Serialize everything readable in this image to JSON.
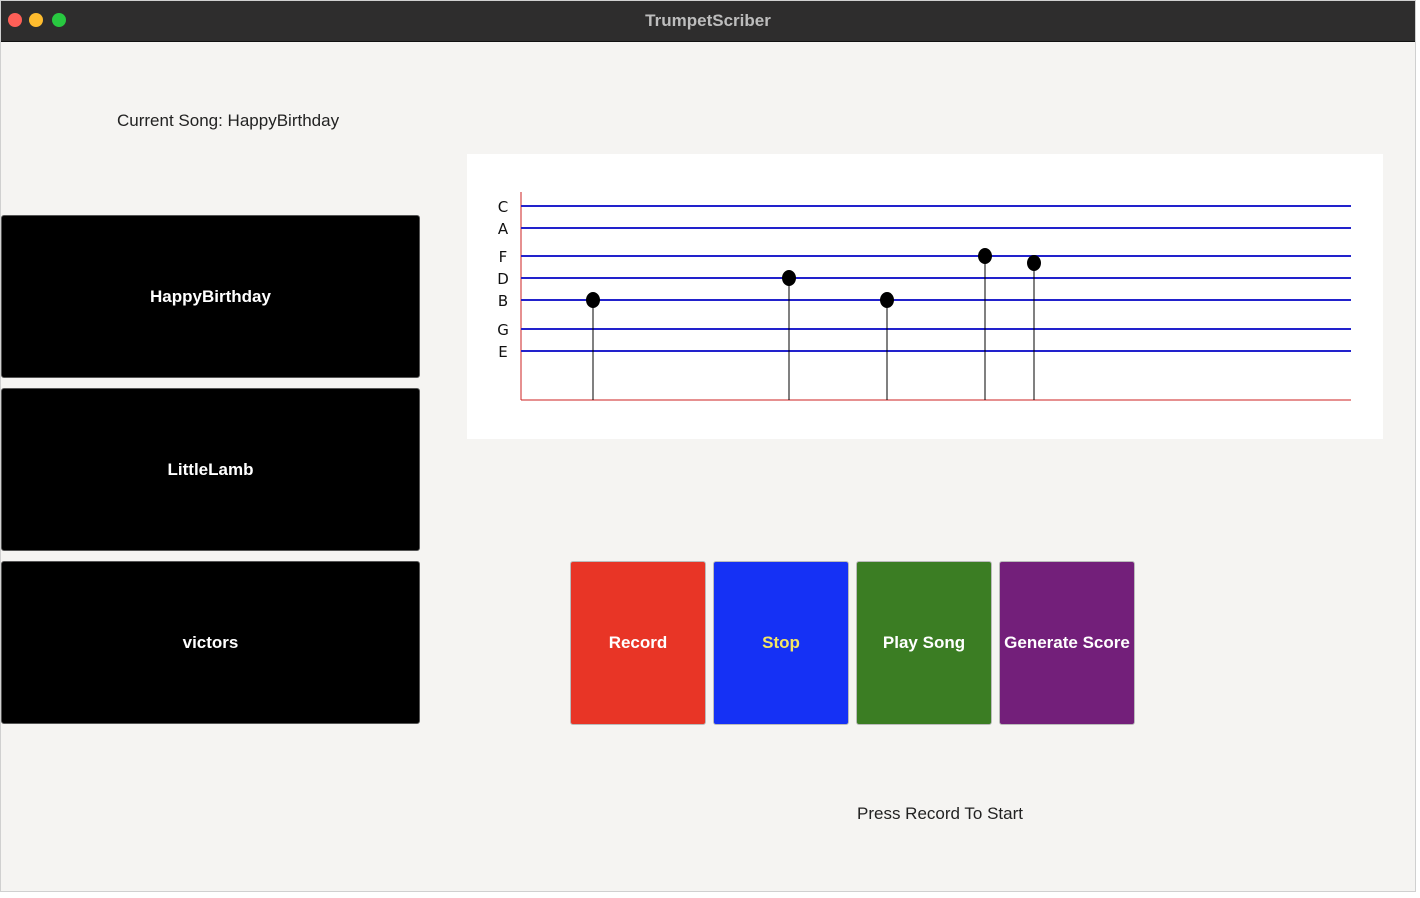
{
  "window": {
    "title": "TrumpetScriber"
  },
  "current_song": {
    "label": "Current Song: HappyBirthday"
  },
  "songs": [
    {
      "label": "HappyBirthday"
    },
    {
      "label": "LittleLamb"
    },
    {
      "label": "victors"
    }
  ],
  "controls": {
    "record": {
      "label": "Record",
      "color": "#e83526",
      "text_color": "#ffffff"
    },
    "stop": {
      "label": "Stop",
      "color": "#1531f5",
      "text_color": "#f5e663"
    },
    "play": {
      "label": "Play Song",
      "color": "#3b7d23",
      "text_color": "#ffffff"
    },
    "generate": {
      "label": "Generate Score",
      "color": "#731f7a",
      "text_color": "#ffffff"
    }
  },
  "status": {
    "text": "Press Record To Start"
  },
  "colors": {
    "staff_line": "#2222cc",
    "axis": "#cc2222",
    "note": "#000000"
  },
  "chart_data": {
    "type": "scatter",
    "title": "",
    "xlabel": "",
    "ylabel": "",
    "y_labels": [
      "C",
      "A",
      "F",
      "D",
      "B",
      "G",
      "E"
    ],
    "notes": [
      {
        "x": 1,
        "y": "B"
      },
      {
        "x": 2,
        "y": "D"
      },
      {
        "x": 3,
        "y": "B"
      },
      {
        "x": 4,
        "y": "F"
      },
      {
        "x": 5,
        "y": "F"
      }
    ]
  }
}
